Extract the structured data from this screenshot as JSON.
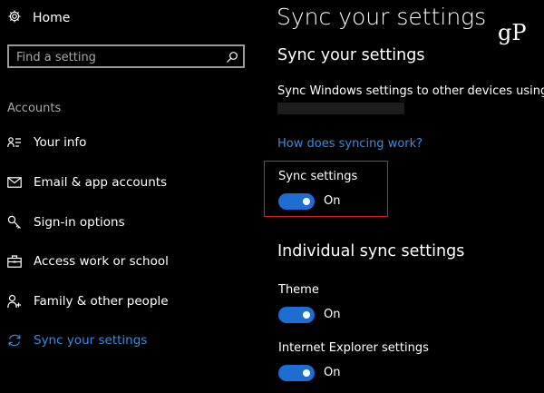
{
  "sidebar": {
    "home_label": "Home",
    "search": {
      "placeholder": "Find a setting"
    },
    "section_heading": "Accounts",
    "items": [
      {
        "label": "Your info",
        "icon": "person-card-icon"
      },
      {
        "label": "Email & app accounts",
        "icon": "envelope-icon"
      },
      {
        "label": "Sign-in options",
        "icon": "key-icon"
      },
      {
        "label": "Access work or school",
        "icon": "briefcase-icon"
      },
      {
        "label": "Family & other people",
        "icon": "person-add-icon"
      },
      {
        "label": "Sync your settings",
        "icon": "sync-icon",
        "active": true
      }
    ]
  },
  "main": {
    "title": "Sync your settings",
    "section_heading": "Sync your settings",
    "description": "Sync Windows settings to other devices using",
    "link": "How does syncing work?",
    "sync_settings": {
      "label": "Sync settings",
      "state": "On",
      "enabled": true
    },
    "individual_heading": "Individual sync settings",
    "toggles": [
      {
        "label": "Theme",
        "state": "On",
        "enabled": true
      },
      {
        "label": "Internet Explorer settings",
        "state": "On",
        "enabled": true
      }
    ]
  },
  "watermark": "gP",
  "colors": {
    "accent": "#1d6dd3",
    "link": "#3a8be0",
    "highlight": "#d41f1f",
    "background": "#000000"
  }
}
